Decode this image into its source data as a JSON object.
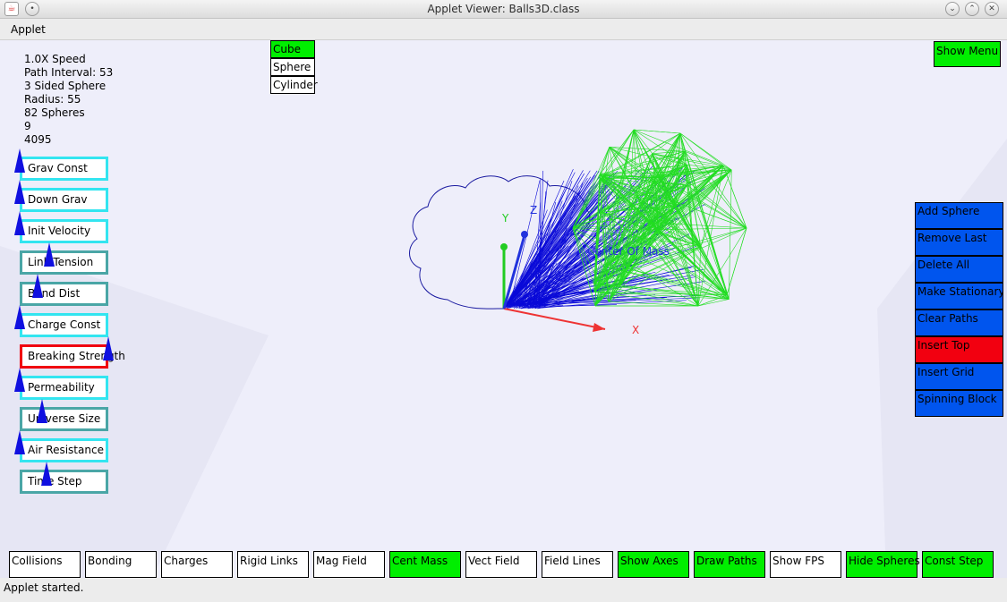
{
  "window": {
    "title": "Applet Viewer: Balls3D.class"
  },
  "menubar": {
    "items": [
      "Applet"
    ]
  },
  "status": "Applet started.",
  "info": [
    "1.0X Speed",
    "Path Interval: 53",
    "3 Sided Sphere",
    "Radius: 55",
    "82 Spheres",
    "9",
    "4095"
  ],
  "sliders": [
    {
      "label": "Grav Const",
      "level": 0.0,
      "style": "cyan"
    },
    {
      "label": "Down Grav",
      "level": 0.0,
      "style": "cyan"
    },
    {
      "label": "Init Velocity",
      "level": 0.0,
      "style": "cyan"
    },
    {
      "label": "Link Tension",
      "level": 0.33,
      "style": "teal"
    },
    {
      "label": "Bond Dist",
      "level": 0.2,
      "style": "teal"
    },
    {
      "label": "Charge Const",
      "level": 0.0,
      "style": "cyan"
    },
    {
      "label": "Breaking Strength",
      "level": 1.0,
      "style": "red"
    },
    {
      "label": "Permeability",
      "level": 0.0,
      "style": "cyan"
    },
    {
      "label": "Universe Size",
      "level": 0.25,
      "style": "teal"
    },
    {
      "label": "Air Resistance",
      "level": 0.0,
      "style": "cyan"
    },
    {
      "label": "Time Step",
      "level": 0.3,
      "style": "teal"
    }
  ],
  "shapes": [
    {
      "label": "Cube",
      "selected": true
    },
    {
      "label": "Sphere",
      "selected": false
    },
    {
      "label": "Cylinder",
      "selected": false
    }
  ],
  "show_menu": "Show Menu",
  "actions": [
    {
      "label": "Add Sphere",
      "active": false
    },
    {
      "label": "Remove Last",
      "active": false
    },
    {
      "label": "Delete All",
      "active": false
    },
    {
      "label": "Make Stationary",
      "active": false
    },
    {
      "label": "Clear Paths",
      "active": false
    },
    {
      "label": "Insert Top",
      "active": true
    },
    {
      "label": "Insert Grid",
      "active": false
    },
    {
      "label": "Spinning Block",
      "active": false
    }
  ],
  "toggles": [
    {
      "label": "Collisions",
      "on": false
    },
    {
      "label": "Bonding",
      "on": false
    },
    {
      "label": "Charges",
      "on": false
    },
    {
      "label": "Rigid Links",
      "on": false
    },
    {
      "label": "Mag Field",
      "on": false
    },
    {
      "label": "Cent Mass",
      "on": true
    },
    {
      "label": "Vect Field",
      "on": false
    },
    {
      "label": "Field Lines",
      "on": false
    },
    {
      "label": "Show Axes",
      "on": true
    },
    {
      "label": "Draw Paths",
      "on": true
    },
    {
      "label": "Show FPS",
      "on": false
    },
    {
      "label": "Hide Spheres",
      "on": true
    },
    {
      "label": "Const Step",
      "on": true
    }
  ],
  "axes": {
    "x": "X",
    "y": "Y",
    "z": "Z"
  },
  "center_label": "Center Of Mass",
  "colors": {
    "on": "#00ee00",
    "action": "#0055ee",
    "alert": "#f20010",
    "slider_cyan": "#33e5f0",
    "slider_teal": "#4aa6a6",
    "slider_red": "#f00010",
    "mesh_green": "#22dd22",
    "mesh_blue": "#0a0ad8",
    "axis_x": "#ee3333",
    "axis_y": "#22cc22",
    "axis_z": "#2233dd"
  }
}
